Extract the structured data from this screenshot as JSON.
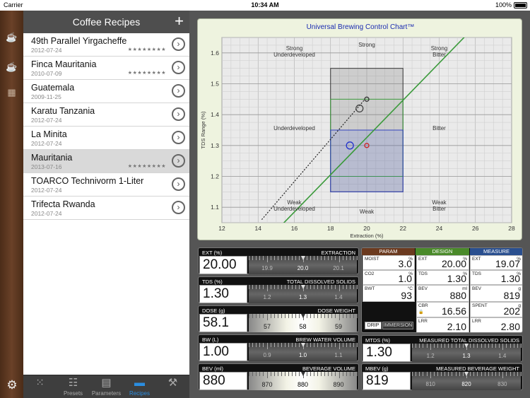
{
  "status": {
    "carrier": "Carrier",
    "time": "10:34 AM",
    "battery": "100%"
  },
  "sidebar_icons": [
    "cup-icon",
    "coffee-cup-icon",
    "coffee-maker-icon"
  ],
  "list": {
    "title": "Coffee Recipes",
    "add_label": "+",
    "stars": "★★★★★★★★",
    "items": [
      {
        "name": "49th Parallel Yirgacheffe",
        "date": "2012-07-24",
        "stars": true
      },
      {
        "name": "Finca Mauritania",
        "date": "2010-07-09",
        "stars": true
      },
      {
        "name": "Guatemala",
        "date": "2009-11-25",
        "stars": false
      },
      {
        "name": "Karatu Tanzania",
        "date": "2012-07-24",
        "stars": false
      },
      {
        "name": "La Minita",
        "date": "2012-07-24",
        "stars": false
      },
      {
        "name": "Mauritania",
        "date": "2013-07-16",
        "stars": true,
        "selected": true
      },
      {
        "name": "TOARCO Technivorm 1-Liter",
        "date": "2012-07-24",
        "stars": false
      },
      {
        "name": "Trifecta Rwanda",
        "date": "2012-07-24",
        "stars": false
      }
    ]
  },
  "tabs": [
    {
      "label": "",
      "icon": "grid-icon"
    },
    {
      "label": "Presets",
      "icon": "sliders-icon"
    },
    {
      "label": "Parameters",
      "icon": "calculator-icon"
    },
    {
      "label": "Recipes",
      "icon": "box-icon",
      "active": true
    },
    {
      "label": "",
      "icon": "wrench-icon"
    }
  ],
  "chart_data": {
    "type": "scatter",
    "title": "Universal Brewing Control Chart™",
    "xlabel": "Extraction (%)",
    "ylabel": "TDS Range (%)",
    "xlim": [
      12,
      28
    ],
    "ylim": [
      1.05,
      1.65
    ],
    "xticks": [
      "12",
      "14",
      "16",
      "18",
      "20",
      "22",
      "24",
      "26",
      "28"
    ],
    "yticks": [
      "1.1",
      "1.2",
      "1.3",
      "1.4",
      "1.5",
      "1.6"
    ],
    "regions": [
      {
        "label": "Strong Underdeveloped",
        "x": 16,
        "y": 1.6
      },
      {
        "label": "Strong",
        "x": 20,
        "y": 1.62
      },
      {
        "label": "Strong Bitter",
        "x": 24,
        "y": 1.6
      },
      {
        "label": "Underdeveloped",
        "x": 16,
        "y": 1.35
      },
      {
        "label": "Bitter",
        "x": 24,
        "y": 1.35
      },
      {
        "label": "Weak Underdeveloped",
        "x": 16,
        "y": 1.1
      },
      {
        "label": "Weak",
        "x": 20,
        "y": 1.08
      },
      {
        "label": "Weak Bitter",
        "x": 24,
        "y": 1.1
      }
    ],
    "ideal_box": {
      "x": [
        18,
        22
      ],
      "y": [
        1.15,
        1.55
      ]
    },
    "green_box": {
      "x": [
        18,
        22
      ],
      "y": [
        1.2,
        1.45
      ]
    },
    "blue_box": {
      "x": [
        18,
        22
      ],
      "y": [
        1.15,
        1.35
      ]
    },
    "points": [
      {
        "x": 19.07,
        "y": 1.3,
        "color": "#2233cc"
      },
      {
        "x": 20,
        "y": 1.3,
        "color": "#cc2222"
      },
      {
        "x": 19.6,
        "y": 1.42,
        "color": "#444"
      },
      {
        "x": 20,
        "y": 1.45,
        "color": "#333"
      }
    ],
    "lines": [
      {
        "color": "#3a9a3a",
        "x": [
          14.6,
          26.2
        ],
        "y": [
          1.0,
          1.7
        ]
      },
      {
        "color": "#222",
        "dash": true,
        "x": [
          14.2,
          19.9
        ],
        "y": [
          1.06,
          1.45
        ]
      }
    ]
  },
  "gauges": {
    "ext": {
      "title": "EXT (%)",
      "name": "EXTRACTION",
      "value": "20.00",
      "ticks": [
        "19.9",
        "20.0",
        "20.1"
      ],
      "light": false
    },
    "tds": {
      "title": "TDS (%)",
      "name": "TOTAL DISSOLVED SOLIDS",
      "value": "1.30",
      "ticks": [
        "1.2",
        "1.3",
        "1.4"
      ],
      "light": false
    },
    "dose": {
      "title": "DOSE (g)",
      "name": "DOSE WEIGHT",
      "value": "58.1",
      "ticks": [
        "57",
        "58",
        "59"
      ],
      "light": true
    },
    "bw": {
      "title": "BW (L)",
      "name": "BREW WATER VOLUME",
      "value": "1.00",
      "ticks": [
        "0.9",
        "1.0",
        "1.1"
      ],
      "light": false
    },
    "bev": {
      "title": "BEV (ml)",
      "name": "BEVERAGE VOLUME",
      "value": "880",
      "ticks": [
        "870",
        "880",
        "890"
      ],
      "light": true
    },
    "mtds": {
      "title": "MTDS (%)",
      "name": "MEASURED TOTAL DISSOLVED SOLIDS",
      "value": "1.30",
      "ticks": [
        "1.2",
        "1.3",
        "1.4"
      ],
      "light": false
    },
    "mbev": {
      "title": "MBEV (g)",
      "name": "MEASURED BEVERAGE WEIGHT",
      "value": "819",
      "ticks": [
        "810",
        "820",
        "830"
      ],
      "light": false
    }
  },
  "params": {
    "headers": {
      "param": "PARAM",
      "design": "DESIGN",
      "measure": "MEASURE"
    },
    "colors": {
      "param": "#6b3a1f",
      "design": "#4a8a2a",
      "measure": "#2a4f8f"
    },
    "param": [
      {
        "k": "MOIST",
        "u": "%",
        "v": "3.0"
      },
      {
        "k": "CO2",
        "u": "%",
        "v": "1.0"
      },
      {
        "k": "BWT",
        "u": "°C",
        "v": "93"
      }
    ],
    "design": [
      {
        "k": "EXT",
        "u": "%",
        "v": "20.00"
      },
      {
        "k": "TDS",
        "u": "%",
        "v": "1.30"
      },
      {
        "k": "BEV",
        "u": "ml",
        "v": "880"
      },
      {
        "k": "CBR",
        "u": "",
        "v": "16.56"
      },
      {
        "k": "LRR",
        "u": "",
        "v": "2.10"
      }
    ],
    "measure": [
      {
        "k": "EXT",
        "u": "%",
        "v": "19.07"
      },
      {
        "k": "TDS",
        "u": "%",
        "v": "1.30"
      },
      {
        "k": "BEV",
        "u": "g",
        "v": "819"
      },
      {
        "k": "SPENT",
        "u": "g",
        "v": "202"
      },
      {
        "k": "LRR",
        "u": "",
        "v": "2.80"
      }
    ],
    "toggle": {
      "drip": "DRIP",
      "immersion": "IMMERSION"
    }
  }
}
